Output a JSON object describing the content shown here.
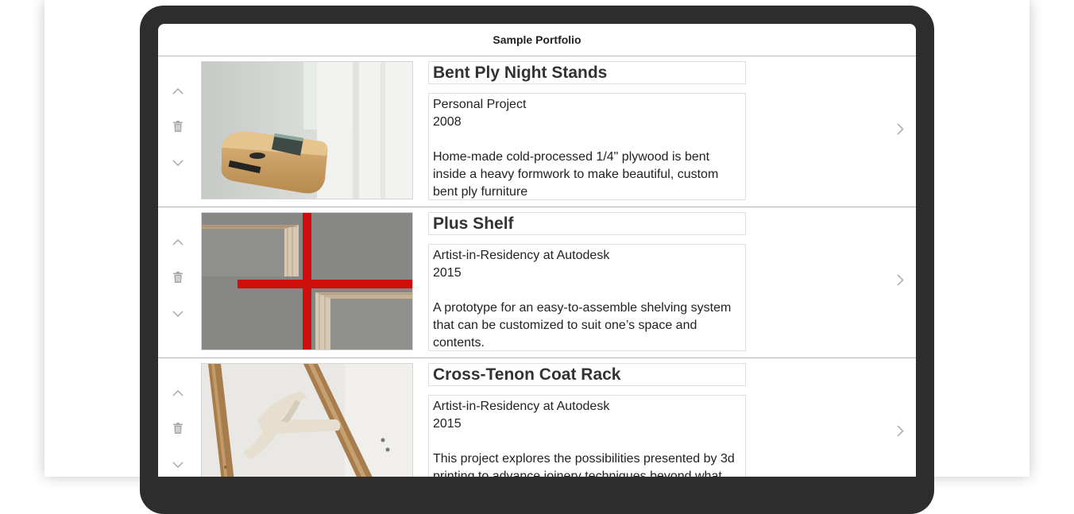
{
  "portfolio": {
    "title": "Sample Portfolio",
    "projects": [
      {
        "title": "Bent Ply Night Stands",
        "description": "Personal Project\n2008\n\nHome-made cold-processed 1/4\" plywood is bent inside a heavy formwork to make beautiful, custom bent ply furniture"
      },
      {
        "title": "Plus Shelf",
        "description": "Artist-in-Residency at Autodesk\n2015\n\nA prototype for an easy-to-assemble shelving system that can be customized to suit one’s space and contents."
      },
      {
        "title": "Cross-Tenon Coat Rack",
        "description": "Artist-in-Residency at Autodesk\n2015\n\nThis project explores the possibilities presented by 3d printing to advance joinery techniques beyond what"
      }
    ]
  },
  "icons": {
    "move_up": "chevron-up-icon",
    "delete": "trash-icon",
    "move_down": "chevron-down-icon",
    "open": "chevron-right-icon"
  },
  "colors": {
    "device_frame": "#2d2d2d",
    "icon_gray": "#a8a8a8",
    "accent_red": "#d41212"
  }
}
